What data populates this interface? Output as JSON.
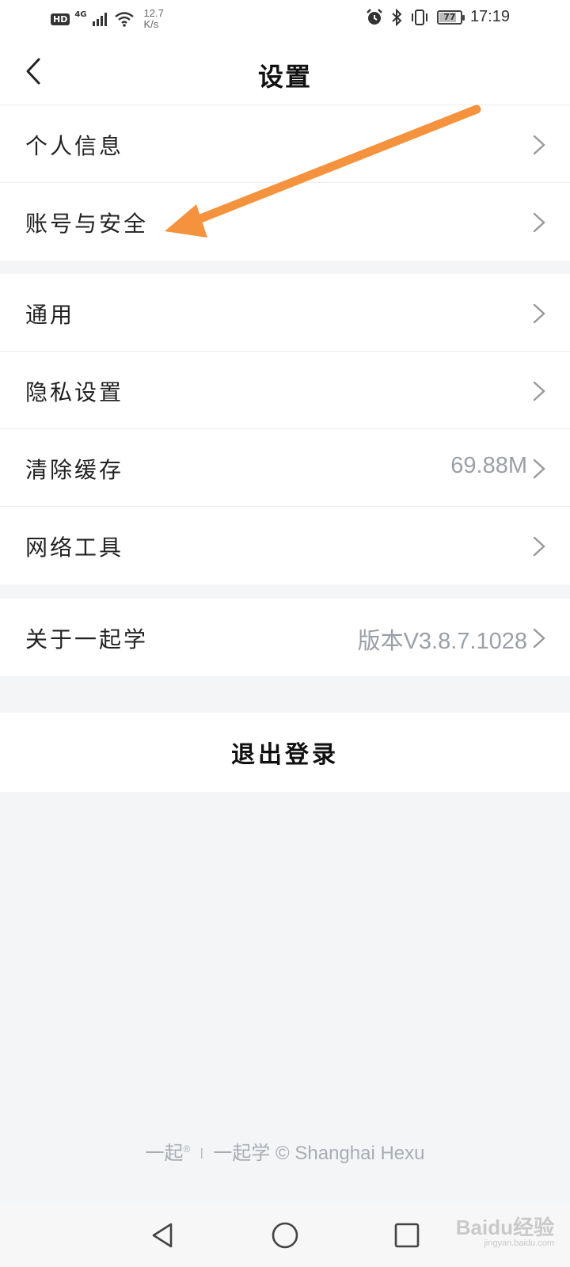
{
  "status_bar": {
    "hd": "HD",
    "network": "4G",
    "speed_value": "12.7",
    "speed_unit": "K/s",
    "battery": "77",
    "time": "17:19"
  },
  "nav": {
    "back_icon": "chevron-left-icon",
    "title": "设置"
  },
  "group1": [
    {
      "label": "个人信息",
      "value": ""
    },
    {
      "label": "账号与安全",
      "value": ""
    }
  ],
  "group2": [
    {
      "label": "通用",
      "value": ""
    },
    {
      "label": "隐私设置",
      "value": ""
    },
    {
      "label": "清除缓存",
      "value": "69.88M"
    },
    {
      "label": "网络工具",
      "value": ""
    }
  ],
  "group3": [
    {
      "label": "关于一起学",
      "value": "版本V3.8.7.1028"
    }
  ],
  "logout": {
    "label": "退出登录"
  },
  "footer": {
    "brand": "一起",
    "registered": "®",
    "separator": "|",
    "text": "一起学 © Shanghai Hexu"
  },
  "watermark": {
    "main": "Baidu经验",
    "sub": "jingyan.baidu.com"
  },
  "colors": {
    "accent_arrow": "#f5923e",
    "secondary_text": "#9aa0a8",
    "background": "#f4f5f7"
  }
}
